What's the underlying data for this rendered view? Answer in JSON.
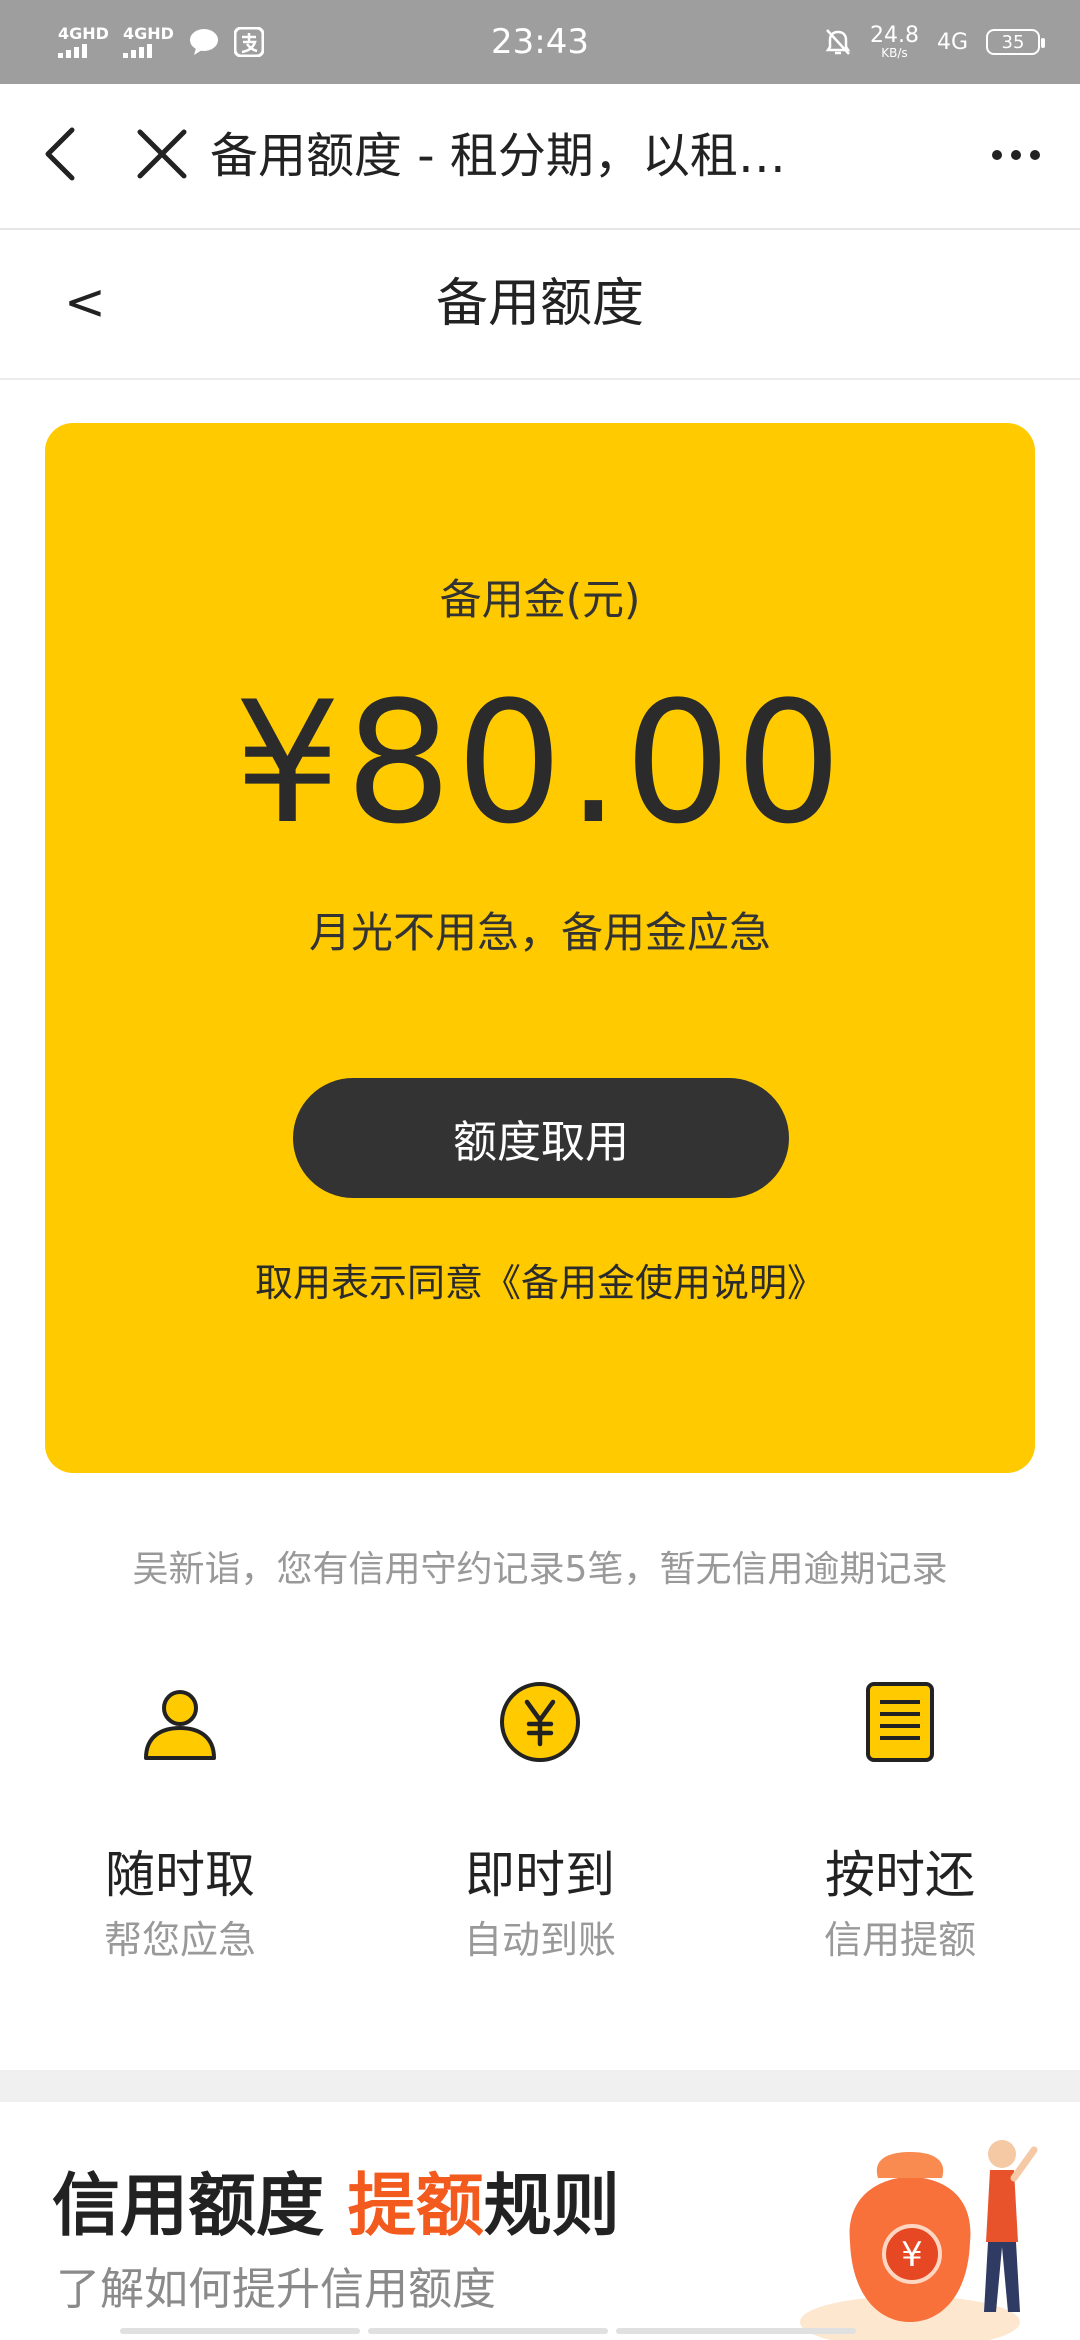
{
  "status_bar": {
    "signal_1": "4GHD",
    "signal_2": "4GHD",
    "time": "23:43",
    "speed_value": "24.8",
    "speed_unit": "KB/s",
    "network": "4G",
    "battery": "35"
  },
  "top_nav": {
    "title": "备用额度 - 租分期，以租…"
  },
  "page_header": {
    "back_label": "<",
    "title": "备用额度"
  },
  "card": {
    "label": "备用金(元)",
    "amount": "¥80.00",
    "slogan": "月光不用急，备用金应急",
    "button": "额度取用",
    "agreement": "取用表示同意《备用金使用说明》",
    "bg_color": "#ffcb00",
    "button_color": "#333333"
  },
  "record_text": "吴新诣，您有信用守约记录5笔，暂无信用逾期记录",
  "features": [
    {
      "icon": "user-icon",
      "title": "随时取",
      "subtitle": "帮您应急"
    },
    {
      "icon": "yen-coin-icon",
      "title": "即时到",
      "subtitle": "自动到账"
    },
    {
      "icon": "document-list-icon",
      "title": "按时还",
      "subtitle": "信用提额"
    }
  ],
  "banner": {
    "title_part1": "信用额度 ",
    "title_highlight": "提额",
    "title_part2": "规则",
    "subtitle": "了解如何提升信用额度",
    "highlight_color": "#f25a1e",
    "art_icon": "money-bag-icon",
    "coin_symbol": "¥"
  }
}
